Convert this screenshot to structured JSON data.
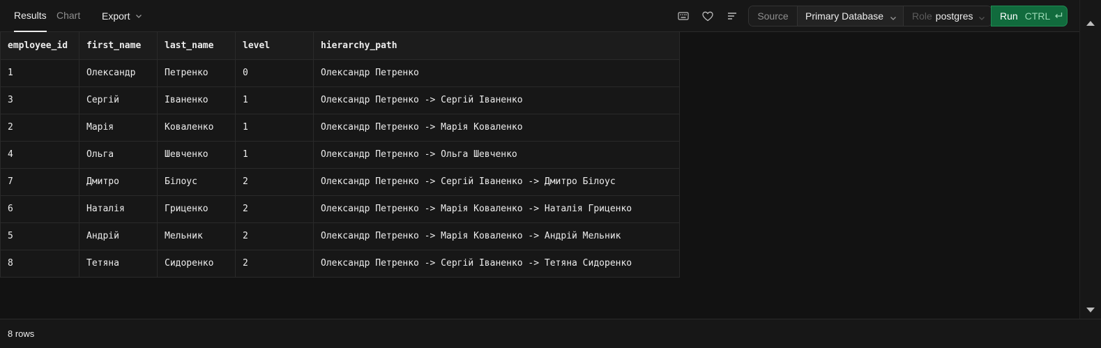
{
  "toolbar": {
    "tabs": [
      {
        "label": "Results",
        "active": true
      },
      {
        "label": "Chart",
        "active": false
      }
    ],
    "export_label": "Export",
    "icons": [
      "keyboard-icon",
      "heart-icon",
      "align-left-icon",
      "chevron-down-icon"
    ],
    "source_label": "Source",
    "database_value": "Primary Database",
    "role_label": "Role",
    "role_value": "postgres",
    "run_label": "Run",
    "run_shortcut": "CTRL",
    "accent_color": "#116b3d"
  },
  "table": {
    "columns": [
      "employee_id",
      "first_name",
      "last_name",
      "level",
      "hierarchy_path"
    ],
    "rows": [
      [
        "1",
        "Олександр",
        "Петренко",
        "0",
        "Олександр Петренко"
      ],
      [
        "3",
        "Сергій",
        "Іваненко",
        "1",
        "Олександр Петренко -> Сергій Іваненко"
      ],
      [
        "2",
        "Марія",
        "Коваленко",
        "1",
        "Олександр Петренко -> Марія Коваленко"
      ],
      [
        "4",
        "Ольга",
        "Шевченко",
        "1",
        "Олександр Петренко -> Ольга Шевченко"
      ],
      [
        "7",
        "Дмитро",
        "Білоус",
        "2",
        "Олександр Петренко -> Сергій Іваненко -> Дмитро Білоус"
      ],
      [
        "6",
        "Наталія",
        "Гриценко",
        "2",
        "Олександр Петренко -> Марія Коваленко -> Наталія Гриценко"
      ],
      [
        "5",
        "Андрій",
        "Мельник",
        "2",
        "Олександр Петренко -> Марія Коваленко -> Андрій Мельник"
      ],
      [
        "8",
        "Тетяна",
        "Сидоренко",
        "2",
        "Олександр Петренко -> Сергій Іваненко -> Тетяна Сидоренко"
      ]
    ]
  },
  "footer": {
    "row_count": "8 rows"
  }
}
